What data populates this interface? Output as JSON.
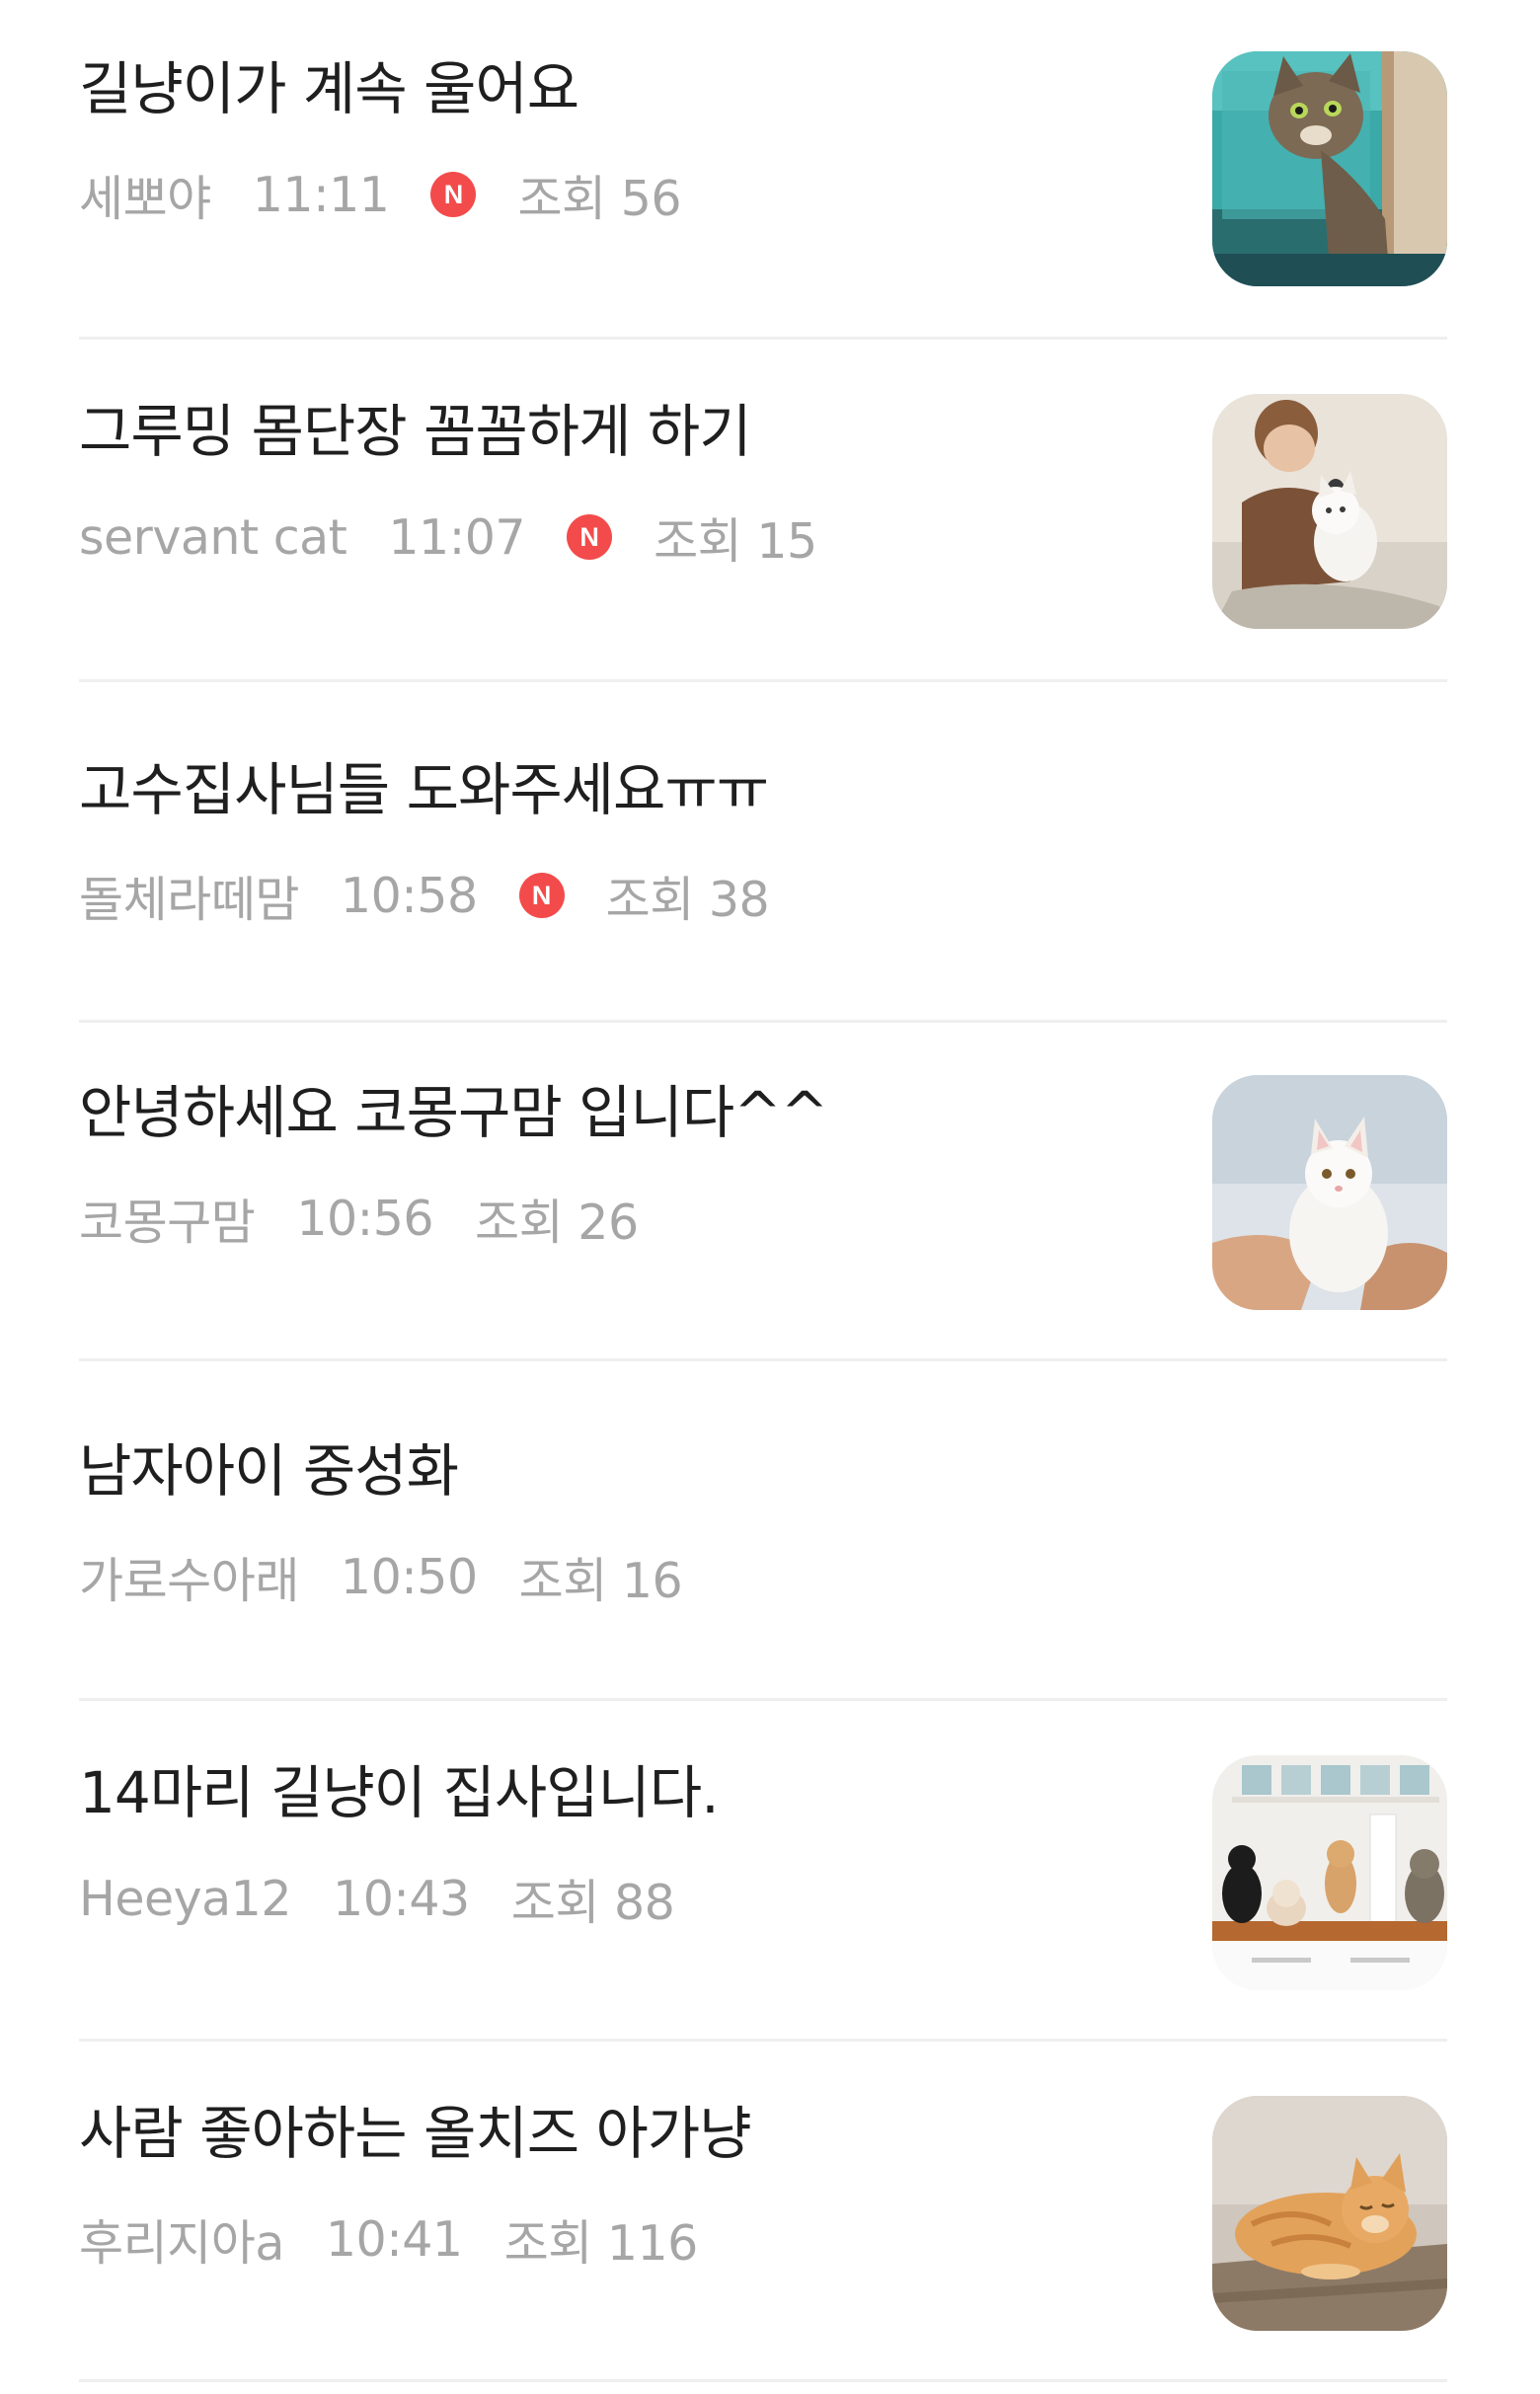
{
  "badge_new_label": "N",
  "posts": [
    {
      "title": "길냥이가 계속 울어요",
      "author": "세뽀야",
      "time": "11:11",
      "is_new": true,
      "views": "조회 56",
      "thumbnail": "tabby-cat-at-window-thumbnail"
    },
    {
      "title": "그루밍 몸단장 꼼꼼하게 하기",
      "author": "servant cat",
      "time": "11:07",
      "is_new": true,
      "views": "조회 15",
      "thumbnail": "child-brushing-white-cat-thumbnail"
    },
    {
      "title": "고수집사님들 도와주세요ㅠㅠ",
      "author": "돌체라떼맘",
      "time": "10:58",
      "is_new": true,
      "views": "조회 38",
      "thumbnail": null
    },
    {
      "title": "안녕하세요 코몽구맘 입니다^^",
      "author": "코몽구맘",
      "time": "10:56",
      "is_new": false,
      "views": "조회 26",
      "thumbnail": "white-kitten-in-hands-thumbnail"
    },
    {
      "title": "남자아이 중성화",
      "author": "가로수아래",
      "time": "10:50",
      "is_new": false,
      "views": "조회 16",
      "thumbnail": null
    },
    {
      "title": "14마리 길냥이 집사입니다.",
      "author": "Heeya12",
      "time": "10:43",
      "is_new": false,
      "views": "조회 88",
      "thumbnail": "cats-on-kitchen-counter-thumbnail"
    },
    {
      "title": "사람 좋아하는 올치즈 아가냥",
      "author": "후리지아a",
      "time": "10:41",
      "is_new": false,
      "views": "조회 116",
      "thumbnail": "orange-cat-lying-on-floor-thumbnail"
    }
  ]
}
